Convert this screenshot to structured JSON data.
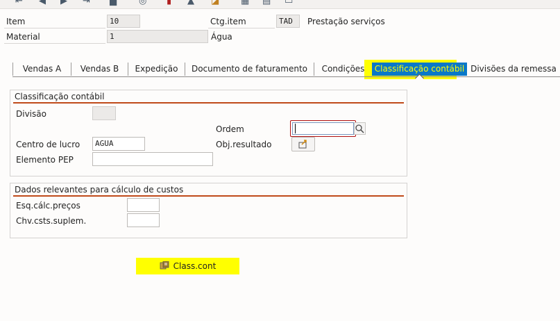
{
  "toolbar": {
    "icons": [
      "first-page-icon",
      "previous-page-icon",
      "next-page-icon",
      "last-page-icon",
      "delete-icon",
      "document-flow-icon",
      "status-icon",
      "user-icon",
      "settings-icon",
      "layout-icon",
      "print-icon"
    ]
  },
  "header": {
    "item_label": "Item",
    "item_value": "10",
    "ctg_item_label": "Ctg.item",
    "ctg_item_value": "TAD",
    "ctg_item_desc": "Prestação serviços",
    "material_label": "Material",
    "material_value": "1",
    "material_desc": "Água"
  },
  "tabs": [
    {
      "label": "Vendas A"
    },
    {
      "label": "Vendas B"
    },
    {
      "label": "Expedição"
    },
    {
      "label": "Documento de faturamento"
    },
    {
      "label": "Condições"
    },
    {
      "label": "Classificação contábil"
    },
    {
      "label": "Divisões da remessa"
    }
  ],
  "classificacao": {
    "title": "Classificação contábil",
    "divisao_label": "Divisão",
    "divisao_value": "",
    "ordem_label": "Ordem",
    "ordem_value": "",
    "centro_lucro_label": "Centro de lucro",
    "centro_lucro_value": "AGUA",
    "obj_resultado_label": "Obj.resultado",
    "elemento_pep_label": "Elemento PEP",
    "elemento_pep_value": ""
  },
  "custos": {
    "title": "Dados relevantes para cálculo de custos",
    "esq_calc_label": "Esq.cálc.preços",
    "esq_calc_value": "",
    "chv_csts_label": "Chv.csts.suplem.",
    "chv_csts_value": ""
  },
  "class_cont_button": {
    "label": "Class.cont"
  },
  "colors": {
    "highlight": "#ffff00",
    "active_tab": "#0a78c8",
    "group_line": "#c04a1a"
  }
}
